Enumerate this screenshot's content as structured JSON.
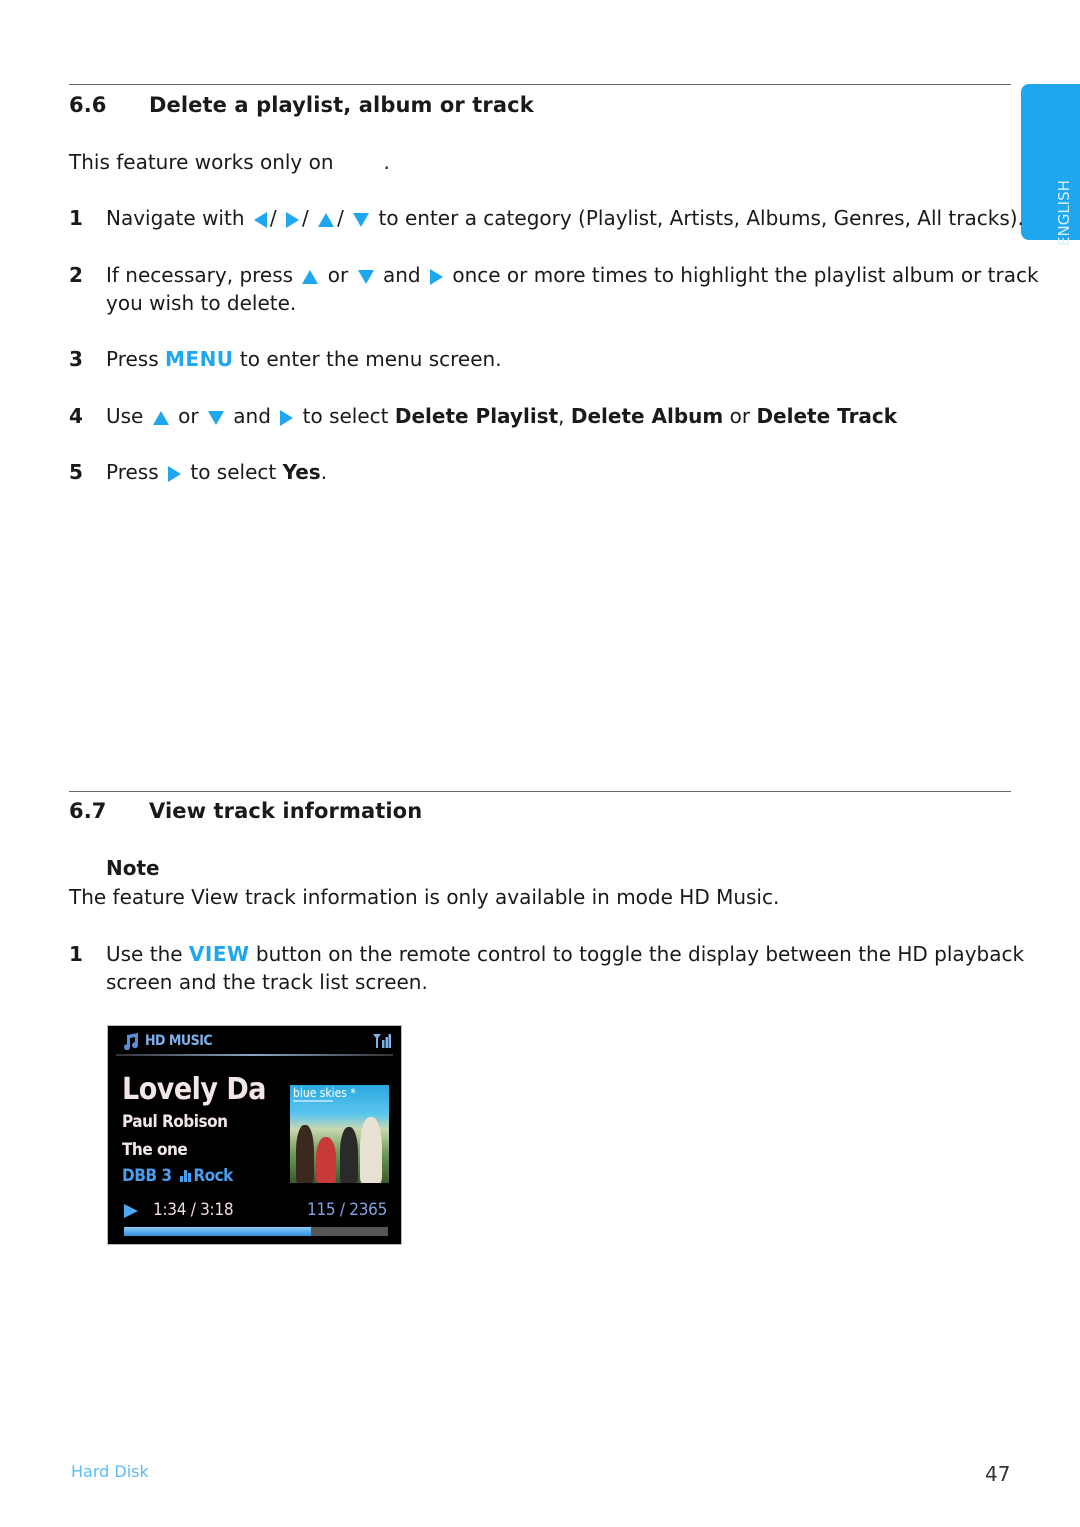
{
  "side_tab": {
    "label": "ENGLISH"
  },
  "section_6_6": {
    "number": "6.6",
    "title": "Delete a playlist, album or track",
    "intro_before": "This feature works only on",
    "intro_after": ".",
    "steps": [
      {
        "n": "1",
        "parts": [
          "Navigate with",
          "/",
          "/",
          "/",
          "to enter a category (Playlist,  Artists,  Albums, Genres,  All tracks)."
        ]
      },
      {
        "n": "2",
        "parts": [
          "If necessary, press",
          "or",
          "and",
          "once or more times to highlight the playlist album or track",
          "you wish to delete."
        ]
      },
      {
        "n": "3",
        "parts": [
          "Press",
          "MENU",
          "to enter the menu screen."
        ]
      },
      {
        "n": "4",
        "parts": [
          "Use",
          "or",
          "and",
          "to select",
          "Delete Playlist",
          ",",
          "Delete Album",
          "or",
          "Delete Track"
        ]
      },
      {
        "n": "5",
        "parts": [
          "Press",
          "to select",
          "Yes",
          "."
        ]
      }
    ]
  },
  "section_6_7": {
    "number": "6.7",
    "title": "View track information",
    "note_heading": "Note",
    "note_text": "The feature View track information is only available in mode HD Music.",
    "steps": [
      {
        "n": "1",
        "parts": [
          "Use the",
          "VIEW",
          "button on the remote control to toggle the display between the HD playback",
          "screen and the track list screen."
        ]
      }
    ]
  },
  "device_screen": {
    "mode": "HD MUSIC",
    "title": "Lovely Da",
    "artist": "Paul Robison",
    "album": "The one",
    "dbb": "DBB 3",
    "genre": "Rock",
    "time": "1:34 / 3:18",
    "track_count": "115 / 2365",
    "progress": 0.71,
    "album_art_text": "blue skies *",
    "icons": {
      "mode": "music-note-icon",
      "signal": "signal-strength-icon",
      "play": "play-icon",
      "eq": "equalizer-icon"
    }
  },
  "footer": {
    "left": "Hard Disk",
    "page": "47"
  },
  "colors": {
    "accent": "#1ea7ee",
    "text": "#1a1a1a",
    "footer_link": "#5bbcf2"
  }
}
